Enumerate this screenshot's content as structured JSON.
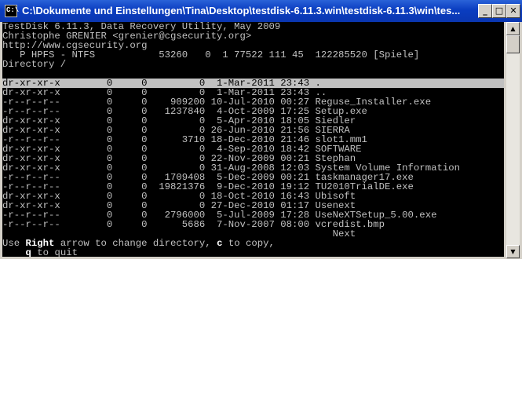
{
  "window": {
    "title": "C:\\Dokumente und Einstellungen\\Tina\\Desktop\\testdisk-6.11.3.win\\testdisk-6.11.3\\win\\tes...",
    "icon_text": "C:\\",
    "icon_name": "console-app-icon",
    "minimize_glyph": "_",
    "maximize_glyph": "□",
    "close_glyph": "✕"
  },
  "console": {
    "header": [
      "TestDisk 6.11.3, Data Recovery Utility, May 2009",
      "Christophe GRENIER <grenier@cgsecurity.org>",
      "http://www.cgsecurity.org",
      "   P HPFS - NTFS           53260   0  1 77522 111 45  122285520 [Spiele]",
      "Directory /"
    ],
    "blank": "",
    "entries": [
      "dr-xr-xr-x        0     0         0  1-Mar-2011 23:43 .",
      "dr-xr-xr-x        0     0         0  1-Mar-2011 23:43 ..",
      "-r--r--r--        0     0    909200 10-Jul-2010 00:27 Reguse_Installer.exe",
      "-r--r--r--        0     0   1237840  4-Oct-2009 17:25 Setup.exe",
      "dr-xr-xr-x        0     0         0  5-Apr-2010 18:05 Siedler",
      "dr-xr-xr-x        0     0         0 26-Jun-2010 21:56 SIERRA",
      "-r--r--r--        0     0      3710 18-Dec-2010 21:46 slot1.mm1",
      "dr-xr-xr-x        0     0         0  4-Sep-2010 18:42 SOFTWARE",
      "dr-xr-xr-x        0     0         0 22-Nov-2009 00:21 Stephan",
      "dr-xr-xr-x        0     0         0 31-Aug-2008 12:03 System Volume Information",
      "-r--r--r--        0     0   1709408  5-Dec-2009 00:21 taskmanager17.exe",
      "-r--r--r--        0     0  19821376  9-Dec-2010 19:12 TU2010TrialDE.exe",
      "dr-xr-xr-x        0     0         0 18-Oct-2010 16:43 Ubisoft",
      "dr-xr-xr-x        0     0         0 27-Dec-2010 01:17 Usenext",
      "-r--r--r--        0     0   2796000  5-Jul-2009 17:28 UseNeXTSetup_5.00.exe",
      "-r--r--r--        0     0      5686  7-Nov-2007 08:00 vcredist.bmp"
    ],
    "next_line": "                                                         Next",
    "help": {
      "prefix": "Use ",
      "key1": "Right",
      "mid": " arrow to change directory, ",
      "key2": "c",
      "suffix": " to copy,",
      "line2_indent": "    ",
      "key3": "q",
      "line2_rest": " to quit"
    }
  },
  "scrollbar": {
    "up_glyph": "▲",
    "down_glyph": "▼"
  },
  "colors": {
    "titlebar": "#0a3dc0",
    "console_bg": "#000000",
    "console_fg": "#c0c0c0",
    "selection_bg": "#c0c0c0"
  }
}
